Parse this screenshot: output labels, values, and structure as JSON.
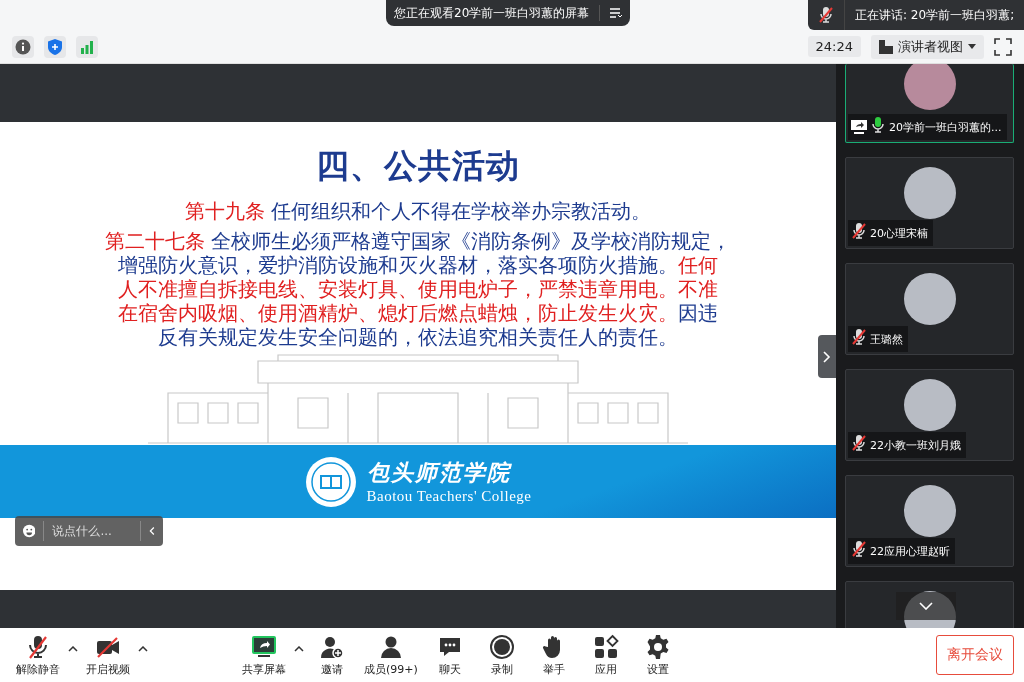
{
  "viewing_banner": {
    "text": "您正在观看20学前一班白羽蕙的屏幕"
  },
  "speaking_banner": {
    "text": "正在讲话: 20学前一班白羽蕙;"
  },
  "toolbar": {
    "timer": "24:24",
    "view_mode": "演讲者视图"
  },
  "slide": {
    "title": "四、公共活动",
    "lines": [
      [
        {
          "kind": "red",
          "text": "第十九条"
        },
        {
          "kind": "blue",
          "text": " 任何组织和个人不得在学校举办宗教活动。"
        }
      ],
      [
        {
          "kind": "red",
          "text": "第二十七条"
        },
        {
          "kind": "blue",
          "text": " 全校师生必须严格遵守国家《消防条例》及学校消防规定，"
        }
      ],
      [
        {
          "kind": "blue",
          "text": "增强防火意识，爱护消防设施和灭火器材，落实各项防火措施。"
        },
        {
          "kind": "red",
          "text": "任何"
        }
      ],
      [
        {
          "kind": "red",
          "text": "人不准擅自拆接电线、安装灯具、使用电炉子，严禁违章用电。不准"
        }
      ],
      [
        {
          "kind": "red",
          "text": "在宿舍内吸烟、使用酒精炉、熄灯后燃点蜡烛，防止发生火灾。"
        },
        {
          "kind": "blue",
          "text": "因违"
        }
      ],
      [
        {
          "kind": "blue",
          "text": "反有关规定发生安全问题的，依法追究相关责任人的责任。"
        }
      ]
    ],
    "logo_name": "包头师范学院",
    "logo_subtitle": "Baotou Teachers' College"
  },
  "chat_input": {
    "placeholder": "说点什么..."
  },
  "participants": [
    {
      "name": "20学前一班白羽蕙的...",
      "muted": false,
      "sharing": true,
      "selected": true
    },
    {
      "name": "20心理宋楠",
      "muted": true,
      "sharing": false,
      "selected": false
    },
    {
      "name": "王璐然",
      "muted": true,
      "sharing": false,
      "selected": false
    },
    {
      "name": "22小教一班刘月娥",
      "muted": true,
      "sharing": false,
      "selected": false
    },
    {
      "name": "22应用心理赵昕",
      "muted": true,
      "sharing": false,
      "selected": false
    }
  ],
  "bottom_bar": {
    "items": [
      {
        "kind": "mic-off",
        "label": "解除静音",
        "caret": true
      },
      {
        "kind": "video-off",
        "label": "开启视频",
        "caret": true
      },
      {
        "kind": "share",
        "label": "共享屏幕",
        "caret": true
      },
      {
        "kind": "invite",
        "label": "邀请",
        "caret": false
      },
      {
        "kind": "members",
        "label": "成员(99+)",
        "caret": false
      },
      {
        "kind": "chat",
        "label": "聊天",
        "caret": false
      },
      {
        "kind": "record",
        "label": "录制",
        "caret": false
      },
      {
        "kind": "hand",
        "label": "举手",
        "caret": false
      },
      {
        "kind": "apps",
        "label": "应用",
        "caret": false
      },
      {
        "kind": "settings",
        "label": "设置",
        "caret": false
      }
    ],
    "leave_button": "离开会议"
  }
}
